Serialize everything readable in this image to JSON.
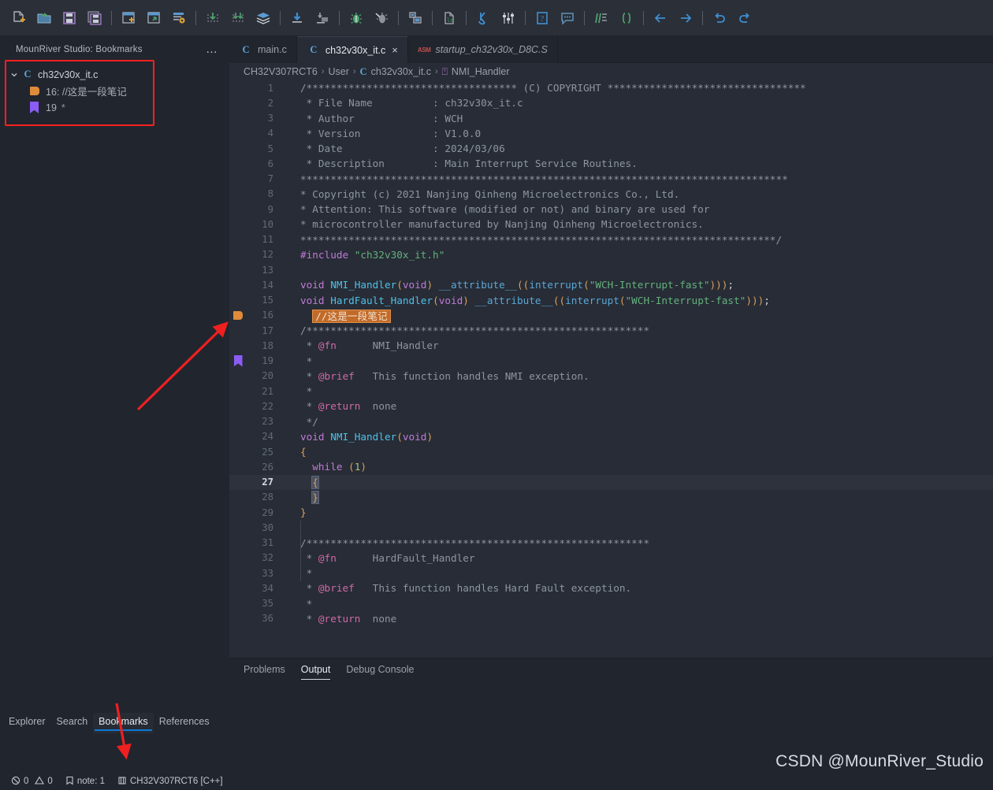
{
  "toolbar": {
    "groups": [
      {
        "items": [
          {
            "name": "new-file-icon",
            "glyph": "new-file"
          },
          {
            "name": "open-folder-icon",
            "glyph": "open-folder"
          },
          {
            "name": "save-icon",
            "glyph": "save"
          },
          {
            "name": "save-all-icon",
            "glyph": "save-all"
          }
        ]
      },
      {
        "items": [
          {
            "name": "new-project-icon",
            "glyph": "new-project"
          },
          {
            "name": "import-project-icon",
            "glyph": "import-project"
          },
          {
            "name": "project-settings-icon",
            "glyph": "project-settings"
          }
        ]
      },
      {
        "items": [
          {
            "name": "build-icon",
            "glyph": "build"
          },
          {
            "name": "rebuild-icon",
            "glyph": "rebuild"
          },
          {
            "name": "build-all-icon",
            "glyph": "build-all"
          }
        ]
      },
      {
        "items": [
          {
            "name": "download-icon",
            "glyph": "download"
          },
          {
            "name": "download-run-icon",
            "glyph": "download-run"
          }
        ]
      },
      {
        "items": [
          {
            "name": "debug-icon",
            "glyph": "debug"
          },
          {
            "name": "debug-attach-icon",
            "glyph": "debug-attach"
          }
        ]
      },
      {
        "items": [
          {
            "name": "serial-monitor-icon",
            "glyph": "serial-monitor"
          }
        ]
      },
      {
        "items": [
          {
            "name": "ld-file-icon",
            "glyph": "ld-file"
          }
        ]
      },
      {
        "items": [
          {
            "name": "wch-link-icon",
            "glyph": "wch-link"
          },
          {
            "name": "tuner-icon",
            "glyph": "tuner"
          }
        ]
      },
      {
        "items": [
          {
            "name": "help-icon",
            "glyph": "help"
          },
          {
            "name": "feedback-icon",
            "glyph": "feedback"
          }
        ]
      },
      {
        "items": [
          {
            "name": "code-format-icon",
            "glyph": "code-format"
          },
          {
            "name": "code-brackets-icon",
            "glyph": "code-brackets"
          }
        ]
      },
      {
        "items": [
          {
            "name": "navigate-back-icon",
            "glyph": "arrow-left"
          },
          {
            "name": "navigate-forward-icon",
            "glyph": "arrow-right"
          }
        ]
      },
      {
        "items": [
          {
            "name": "undo-icon",
            "glyph": "undo"
          },
          {
            "name": "redo-icon",
            "glyph": "redo"
          }
        ]
      }
    ]
  },
  "sidebar": {
    "title": "MounRiver Studio: Bookmarks",
    "more_actions": "…",
    "tree": [
      {
        "level": 0,
        "icon": "c-file-icon",
        "icon_text": "C",
        "label": "ch32v30x_it.c",
        "expanded": true
      },
      {
        "level": 1,
        "icon": "note-tag-icon",
        "label": "16: //这是一段笔记",
        "suffix": ""
      },
      {
        "level": 1,
        "icon": "bookmark-icon",
        "label": "19",
        "suffix": "*"
      }
    ],
    "tabs": [
      {
        "label": "Explorer",
        "active": false
      },
      {
        "label": "Search",
        "active": false
      },
      {
        "label": "Bookmarks",
        "active": true
      },
      {
        "label": "References",
        "active": false
      }
    ]
  },
  "editor": {
    "tabs": [
      {
        "label": "main.c",
        "icon": "C",
        "icon_type": "c",
        "active": false,
        "closable": false,
        "italic": false
      },
      {
        "label": "ch32v30x_it.c",
        "icon": "C",
        "icon_type": "c",
        "active": true,
        "closable": true,
        "close_glyph": "×",
        "italic": false
      },
      {
        "label": "startup_ch32v30x_D8C.S",
        "icon": "ASM",
        "icon_type": "asm",
        "active": false,
        "closable": false,
        "italic": true
      }
    ],
    "breadcrumb": [
      "CH32V307RCT6",
      "User",
      "ch32v30x_it.c",
      "NMI_Handler"
    ],
    "breadcrumb_separator": "›",
    "current_line": 27,
    "lines": [
      {
        "n": 1,
        "text": "/*********************************** (C) COPYRIGHT *********************************"
      },
      {
        "n": 2,
        "text": " * File Name          : ch32v30x_it.c"
      },
      {
        "n": 3,
        "text": " * Author             : WCH"
      },
      {
        "n": 4,
        "text": " * Version            : V1.0.0"
      },
      {
        "n": 5,
        "text": " * Date               : 2024/03/06"
      },
      {
        "n": 6,
        "text": " * Description        : Main Interrupt Service Routines."
      },
      {
        "n": 7,
        "text": "*********************************************************************************"
      },
      {
        "n": 8,
        "text": "* Copyright (c) 2021 Nanjing Qinheng Microelectronics Co., Ltd."
      },
      {
        "n": 9,
        "text": "* Attention: This software (modified or not) and binary are used for"
      },
      {
        "n": 10,
        "text": "* microcontroller manufactured by Nanjing Qinheng Microelectronics."
      },
      {
        "n": 11,
        "text": "*******************************************************************************/"
      },
      {
        "n": 12,
        "text": "#include \"ch32v30x_it.h\""
      },
      {
        "n": 13,
        "text": ""
      },
      {
        "n": 14,
        "text": "void NMI_Handler(void) __attribute__((interrupt(\"WCH-Interrupt-fast\")));"
      },
      {
        "n": 15,
        "text": "void HardFault_Handler(void) __attribute__((interrupt(\"WCH-Interrupt-fast\")));"
      },
      {
        "n": 16,
        "text": "  //这是一段笔记",
        "gutter": "note"
      },
      {
        "n": 17,
        "text": "/*********************************************************"
      },
      {
        "n": 18,
        "text": " * @fn      NMI_Handler"
      },
      {
        "n": 19,
        "text": " *",
        "gutter": "bookmark"
      },
      {
        "n": 20,
        "text": " * @brief   This function handles NMI exception."
      },
      {
        "n": 21,
        "text": " *"
      },
      {
        "n": 22,
        "text": " * @return  none"
      },
      {
        "n": 23,
        "text": " */"
      },
      {
        "n": 24,
        "text": "void NMI_Handler(void)"
      },
      {
        "n": 25,
        "text": "{"
      },
      {
        "n": 26,
        "text": "  while (1)"
      },
      {
        "n": 27,
        "text": "  {"
      },
      {
        "n": 28,
        "text": "  }"
      },
      {
        "n": 29,
        "text": "}"
      },
      {
        "n": 30,
        "text": ""
      },
      {
        "n": 31,
        "text": "/*********************************************************"
      },
      {
        "n": 32,
        "text": " * @fn      HardFault_Handler"
      },
      {
        "n": 33,
        "text": " *"
      },
      {
        "n": 34,
        "text": " * @brief   This function handles Hard Fault exception."
      },
      {
        "n": 35,
        "text": " *"
      },
      {
        "n": 36,
        "text": " * @return  none"
      }
    ]
  },
  "panel": {
    "tabs": [
      {
        "label": "Problems",
        "active": false
      },
      {
        "label": "Output",
        "active": true
      },
      {
        "label": "Debug Console",
        "active": false
      }
    ],
    "content": ""
  },
  "status_bar": {
    "errors_icon": "error-circle-icon",
    "errors": "0",
    "warnings_icon": "warning-triangle-icon",
    "warnings": "0",
    "note_icon": "bookmark-icon",
    "note": "note: 1",
    "target_icon": "chip-icon",
    "target": "CH32V307RCT6 [C++]"
  },
  "watermark": "CSDN @MounRiver_Studio",
  "annotations": {
    "highlight_box_color": "#ff2020",
    "arrow_color": "#ee2020",
    "arrows": [
      {
        "name": "arrow-to-gutter-markers"
      },
      {
        "name": "arrow-to-bookmarks-tab"
      }
    ]
  },
  "colors": {
    "background": "#272c36",
    "sidebar": "#21252e",
    "toolbar": "#2b2f38",
    "accent": "#0b7ad6",
    "note_marker": "#e08b39",
    "bookmark_marker": "#8b5cf6"
  }
}
